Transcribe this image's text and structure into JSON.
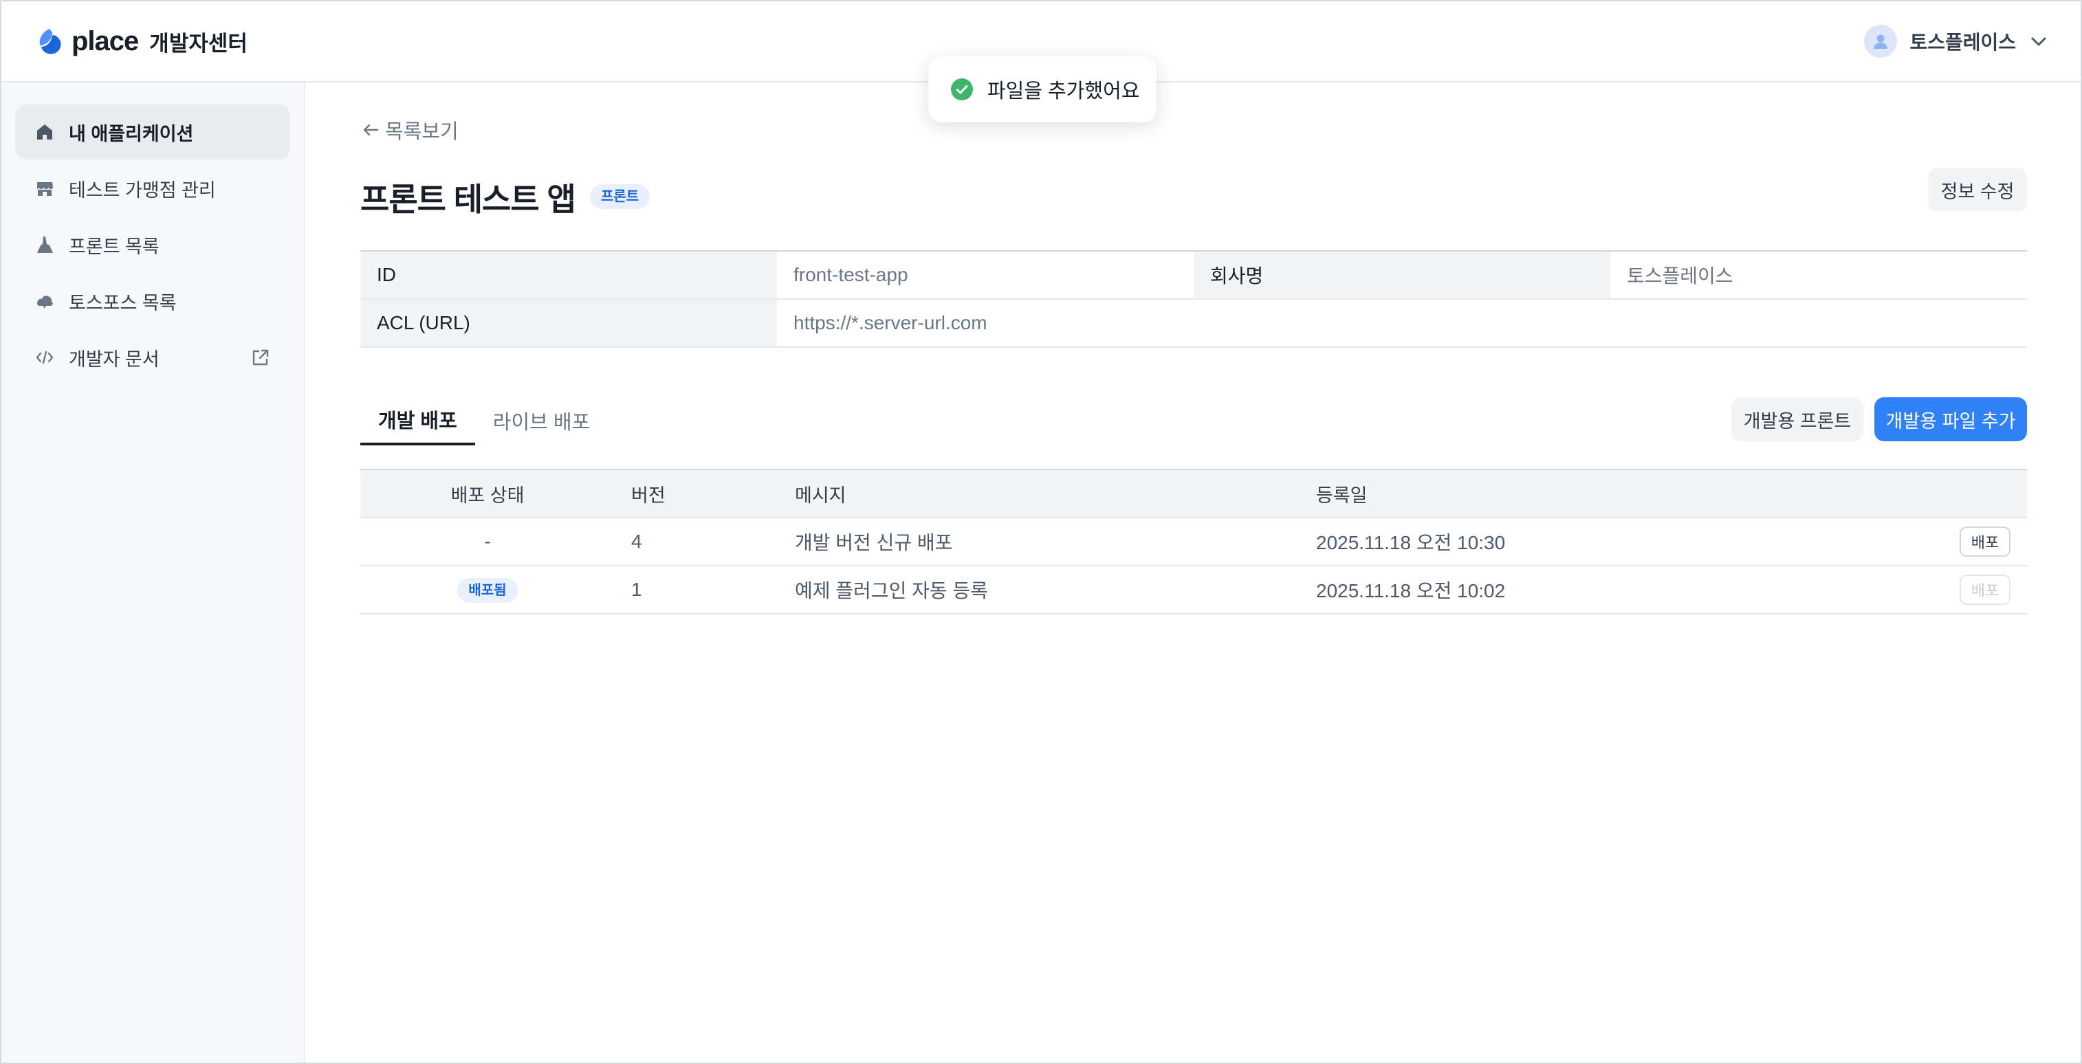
{
  "header": {
    "brand": "place",
    "brand_sub": "개발자센터",
    "user_name": "토스플레이스"
  },
  "toast": {
    "message": "파일을 추가했어요"
  },
  "sidebar": {
    "items": [
      {
        "label": "내 애플리케이션",
        "icon": "home-icon",
        "active": true
      },
      {
        "label": "테스트 가맹점 관리",
        "icon": "store-icon"
      },
      {
        "label": "프론트 목록",
        "icon": "brush-icon"
      },
      {
        "label": "토스포스 목록",
        "icon": "cloud-icon"
      },
      {
        "label": "개발자 문서",
        "icon": "code-icon",
        "external": true
      }
    ]
  },
  "main": {
    "back_label": "목록보기",
    "title": "프론트 테스트 앱",
    "title_badge": "프론트",
    "edit_button": "정보 수정",
    "info": {
      "id_label": "ID",
      "id_value": "front-test-app",
      "company_label": "회사명",
      "company_value": "토스플레이스",
      "acl_label": "ACL (URL)",
      "acl_value": "https://*.server-url.com"
    },
    "tabs": [
      {
        "label": "개발 배포",
        "active": true
      },
      {
        "label": "라이브 배포"
      }
    ],
    "dev_front_button": "개발용 프론트",
    "add_file_button": "개발용 파일 추가",
    "table": {
      "headers": [
        "배포 상태",
        "버전",
        "메시지",
        "등록일"
      ],
      "rows": [
        {
          "status": "-",
          "version": "4",
          "message": "개발 버전 신규 배포",
          "date": "2025.11.18 오전 10:30",
          "action": "배포"
        },
        {
          "status": "배포됨",
          "version": "1",
          "message": "예제 플러그인 자동 등록",
          "date": "2025.11.18 오전 10:02",
          "action": "배포"
        }
      ]
    }
  },
  "colors": {
    "accent": "#3182f6",
    "badge_bg": "#e8f0fe",
    "badge_text": "#1b64da",
    "success": "#3fb56b",
    "sidebar_bg": "#f7f8fa"
  }
}
